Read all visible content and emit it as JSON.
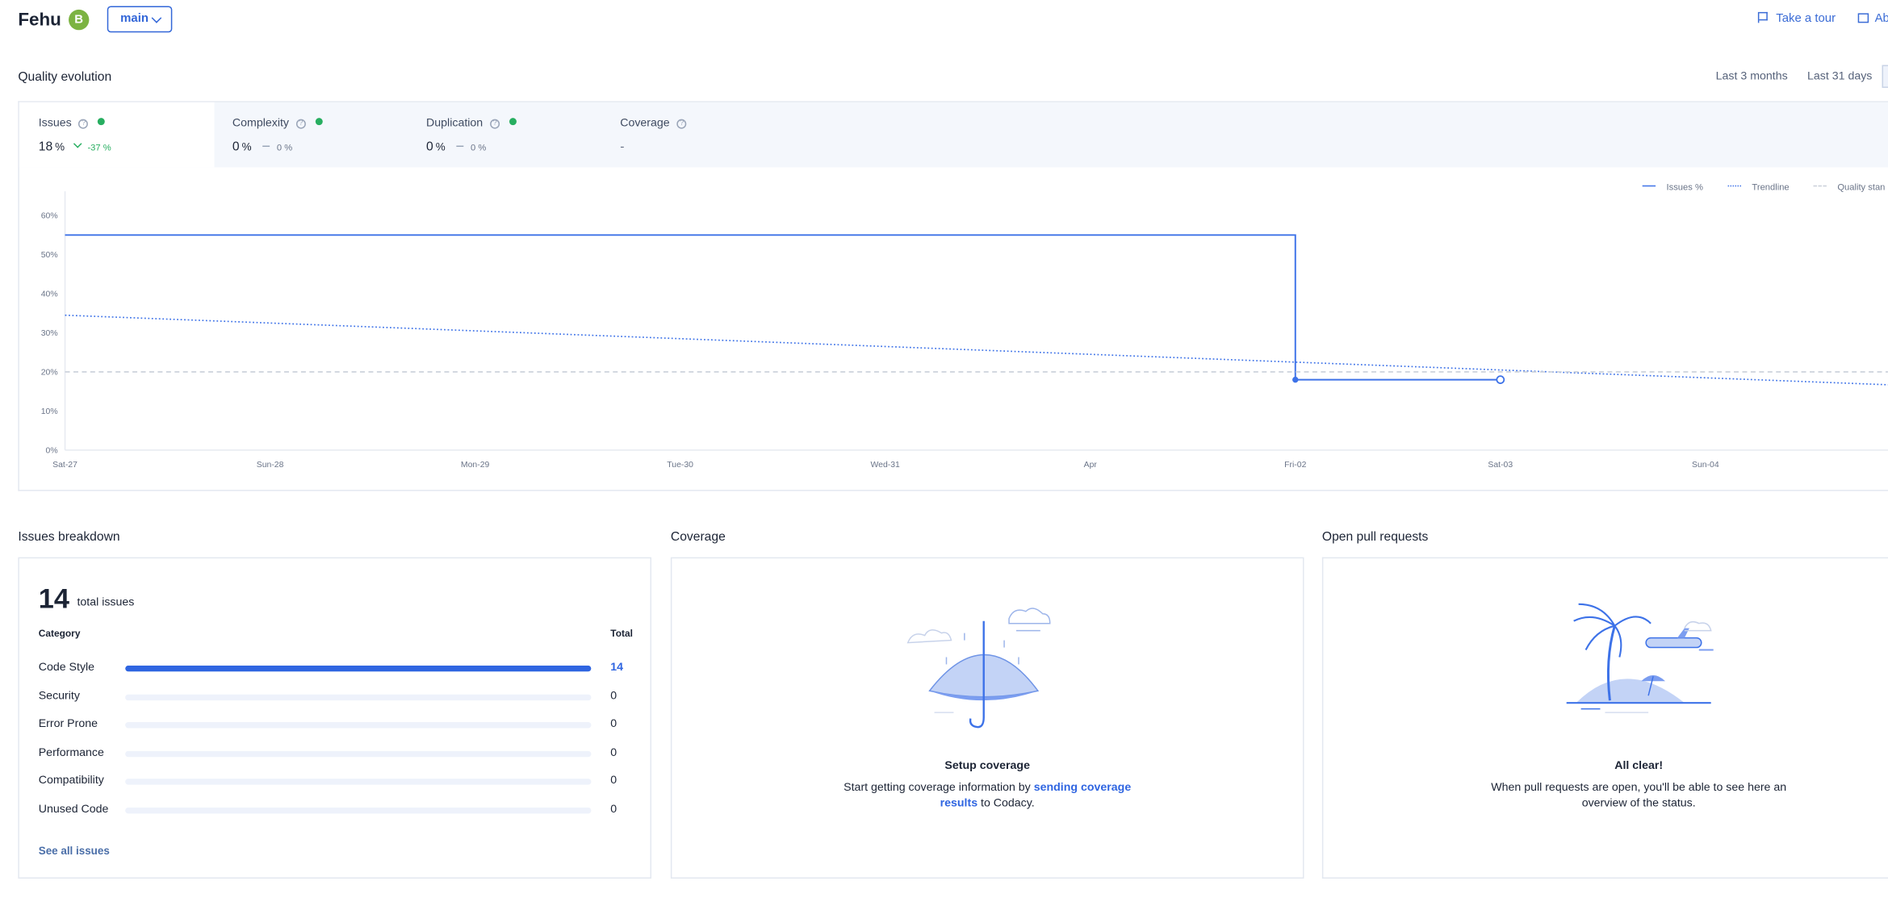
{
  "header": {
    "repo_name": "Fehu",
    "grade": "B",
    "branch": "main",
    "take_tour": "Take a tour",
    "about": "Ab"
  },
  "quality_evolution": {
    "title": "Quality evolution",
    "ranges": [
      "Last 3 months",
      "Last 31 days"
    ],
    "tabs": [
      {
        "label": "Issues",
        "value": "18",
        "unit": "%",
        "delta": "-37 %",
        "status": "good"
      },
      {
        "label": "Complexity",
        "value": "0",
        "unit": "%",
        "delta": "0 %",
        "status": "good"
      },
      {
        "label": "Duplication",
        "value": "0",
        "unit": "%",
        "delta": "0 %",
        "status": "good"
      },
      {
        "label": "Coverage",
        "value": "-",
        "unit": "",
        "delta": "",
        "status": "none"
      }
    ],
    "legend": [
      "Issues %",
      "Trendline",
      "Quality stan"
    ]
  },
  "chart_data": {
    "type": "line",
    "x": [
      "Sat-27",
      "Sun-28",
      "Mon-29",
      "Tue-30",
      "Wed-31",
      "Apr",
      "Fri-02",
      "Sat-03",
      "Sun-04"
    ],
    "y_ticks": [
      "0%",
      "10%",
      "20%",
      "30%",
      "40%",
      "50%",
      "60%"
    ],
    "ylim": [
      0,
      60
    ],
    "series": [
      {
        "name": "Issues %",
        "style": "step-solid",
        "color": "#3d72e8",
        "points": [
          [
            "Sat-27",
            55
          ],
          [
            "Fri-02",
            55
          ],
          [
            "Fri-02",
            18
          ],
          [
            "Sat-03",
            18
          ]
        ]
      },
      {
        "name": "Trendline",
        "style": "dotted",
        "color": "#3d72e8",
        "points": [
          [
            "Sat-27",
            34.5
          ],
          [
            "Sun-04",
            18.5
          ]
        ]
      },
      {
        "name": "Quality stan",
        "style": "dashed",
        "color": "#c9cfd9",
        "points": [
          [
            "Sat-27",
            20
          ],
          [
            "Sun-04",
            20
          ]
        ]
      }
    ]
  },
  "issues_breakdown": {
    "title": "Issues breakdown",
    "total": "14",
    "total_label": "total issues",
    "category_header": "Category",
    "total_header": "Total",
    "categories": [
      {
        "name": "Code Style",
        "count": 14,
        "fraction": 1.0
      },
      {
        "name": "Security",
        "count": 0,
        "fraction": 0
      },
      {
        "name": "Error Prone",
        "count": 0,
        "fraction": 0
      },
      {
        "name": "Performance",
        "count": 0,
        "fraction": 0
      },
      {
        "name": "Compatibility",
        "count": 0,
        "fraction": 0
      },
      {
        "name": "Unused Code",
        "count": 0,
        "fraction": 0
      }
    ],
    "see_all": "See all issues"
  },
  "coverage": {
    "title": "Coverage",
    "empty_title": "Setup coverage",
    "text_before": "Start getting coverage information by ",
    "link": "sending coverage results",
    "text_after": " to Codacy."
  },
  "pull_requests": {
    "title": "Open pull requests",
    "empty_title": "All clear!",
    "text": "When pull requests are open, you'll be able to see here an overview of the status."
  },
  "colors": {
    "accent": "#3266d8",
    "good": "#27ae60",
    "grade": "#7cb342"
  }
}
